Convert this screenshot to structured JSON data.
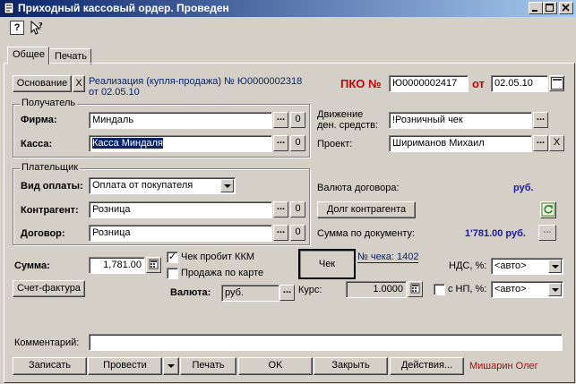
{
  "window": {
    "title": "Приходный кассовый ордер. Проведен"
  },
  "toolbar": {
    "help": "?"
  },
  "tabs": [
    {
      "label": "Общее"
    },
    {
      "label": "Печать"
    }
  ],
  "header": {
    "basis_button": "Основание",
    "basis_clear": "X",
    "basis_text": "Реализация (купля-продажа) № Ю0000002318 от 02.05.10",
    "pko_label": "ПКО №",
    "pko_number": "Ю0000002417",
    "date_label": "от",
    "date": "02.05.10"
  },
  "recipient": {
    "group_label": "Получатель",
    "firm_label": "Фирма:",
    "firm_value": "Миндаль",
    "cash_label": "Касса:",
    "cash_value": "Касса Миндаля",
    "movement_label_1": "Движение",
    "movement_label_2": "ден. средств:",
    "movement_value": "!Розничный чек",
    "project_label": "Проект:",
    "project_value": "Шириманов Михаил",
    "dots": "...",
    "zero": "0",
    "clear": "X"
  },
  "payer": {
    "group_label": "Плательщик",
    "payment_type_label": "Вид оплаты:",
    "payment_type_value": "Оплата от покупателя",
    "contractor_label": "Контрагент:",
    "contractor_value": "Розница",
    "contract_label": "Договор:",
    "contract_value": "Розница",
    "currency_label": "Валюта договора:",
    "currency_value": "руб.",
    "debt_button": "Долг контрагента",
    "doc_sum_label": "Сумма по документу:",
    "doc_sum_value": "1'781.00 руб.",
    "dots": "...",
    "zero": "0"
  },
  "bottom": {
    "sum_label": "Сумма:",
    "sum_value": "1,781.00",
    "check_kkm_label": "Чек пробит ККМ",
    "check_kkm_checked": "✓",
    "card_sale_label": "Продажа по карте",
    "check_button": "Чек",
    "check_number": "№ чека: 1402",
    "vat_label": "НДС, %:",
    "vat_value": "<авто>",
    "invoice_button": "Счет-фактура",
    "currency_label": "Валюта:",
    "currency_value": "руб.",
    "rate_label": "Курс:",
    "rate_value": "1.0000",
    "np_label": "с НП, %:",
    "np_value": "<авто>",
    "dots": "..."
  },
  "comment": {
    "label": "Комментарий:",
    "value": ""
  },
  "actions": {
    "save": "Записать",
    "post": "Провести",
    "print": "Печать",
    "ok": "OK",
    "close": "Закрыть",
    "actions": "Действия...",
    "author": "Мишарин Олег"
  },
  "colors": {
    "link_blue": "#0a246a",
    "pko_red": "#cc0000",
    "author_red": "#a01010",
    "value_blue": "#1c1c9c"
  }
}
